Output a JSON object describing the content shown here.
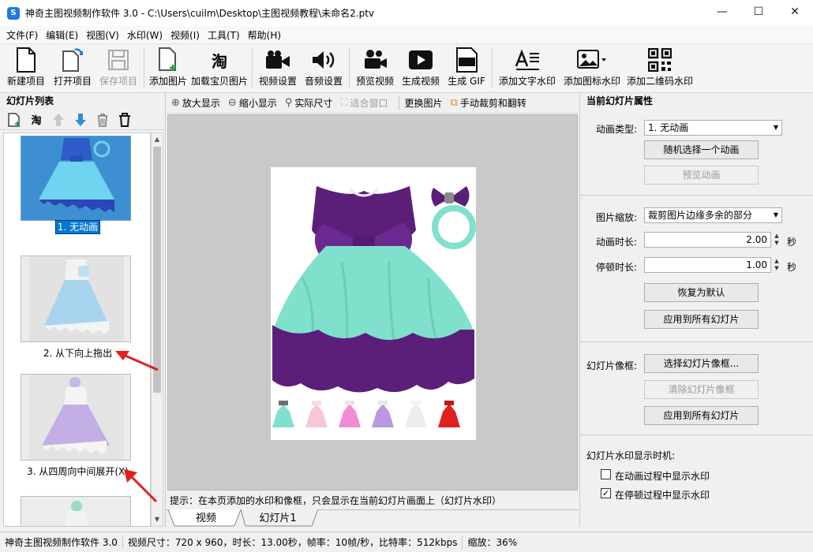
{
  "window": {
    "title": "神奇主图视频制作软件 3.0 - C:\\Users\\cuilm\\Desktop\\主图视频教程\\未命名2.ptv",
    "app_icon_glyph": "S",
    "controls": {
      "minimize": "—",
      "maximize": "☐",
      "close": "✕"
    }
  },
  "menu": [
    "文件(F)",
    "编辑(E)",
    "视图(V)",
    "水印(W)",
    "视频(I)",
    "工具(T)",
    "帮助(H)"
  ],
  "toolbar": {
    "new": "新建项目",
    "open": "打开项目",
    "save": "保存项目",
    "add_image": "添加图片",
    "load_taobao": "加载宝贝图片",
    "video_settings": "视频设置",
    "audio_settings": "音频设置",
    "preview": "预览视频",
    "generate": "生成视频",
    "gif": "生成 GIF",
    "text_watermark": "添加文字水印",
    "icon_watermark": "添加图标水印",
    "qr_watermark": "添加二维码水印",
    "taobao_glyph": "淘",
    "gif_badge": "GIF"
  },
  "left_panel": {
    "title": "幻灯片列表",
    "taobao_glyph": "淘",
    "slides": [
      {
        "label": "1. 无动画",
        "selected": true
      },
      {
        "label": "2. 从下向上拖出",
        "selected": false
      },
      {
        "label": "3. 从四周向中间展开(X)",
        "selected": false
      }
    ]
  },
  "view_toolbar": {
    "zoom_in": "放大显示",
    "zoom_out": "缩小显示",
    "actual": "实际尺寸",
    "fit": "适合窗口",
    "replace": "更换图片",
    "crop": "手动裁剪和翻转"
  },
  "hint": "提示：在本页添加的水印和像框，只会显示在当前幻灯片画面上（幻灯片水印）",
  "tabs": [
    "视频",
    "幻灯片1"
  ],
  "properties": {
    "title": "当前幻灯片属性",
    "anim_type_label": "动画类型:",
    "anim_type_value": "1. 无动画",
    "random_btn": "随机选择一个动画",
    "preview_btn": "预览动画",
    "scale_label": "图片缩放:",
    "scale_value": "裁剪图片边缘多余的部分",
    "duration_label": "动画时长:",
    "duration_value": "2.00",
    "pause_label": "停顿时长:",
    "pause_value": "1.00",
    "seconds": "秒",
    "reset_btn": "恢复为默认",
    "apply_all_btn": "应用到所有幻灯片",
    "frame_label": "幻灯片像框:",
    "choose_frame_btn": "选择幻灯片像框...",
    "clear_frame_btn": "清除幻灯片像框",
    "apply_frame_btn": "应用到所有幻灯片",
    "watermark_timing_label": "幻灯片水印显示时机:",
    "chk_anim": "在动画过程中显示水印",
    "chk_anim_checked": false,
    "chk_pause": "在停顿过程中显示水印",
    "chk_pause_checked": true
  },
  "status": {
    "app": "神奇主图视频制作软件 3.0",
    "info": "视频尺寸：720 x 960，时长：13.00秒，帧率：10帧/秒，比特率：512kbps",
    "zoom": "缩放：36%"
  },
  "colors": {
    "accent": "#1f7ae0",
    "selection": "#0078d7",
    "arrow": "#e02020",
    "dress_purple": "#5b1f7a",
    "dress_teal": "#7fe0cc"
  }
}
